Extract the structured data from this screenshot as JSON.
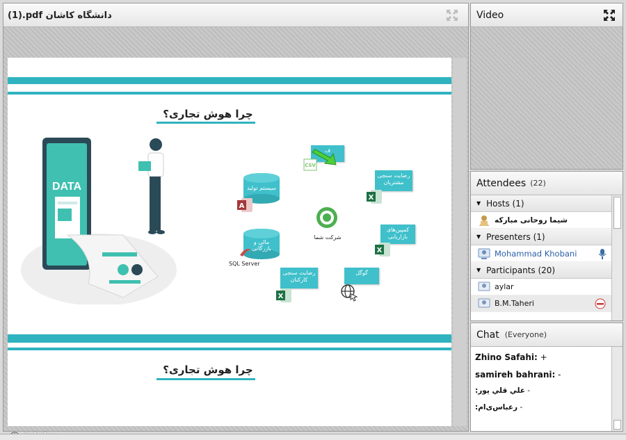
{
  "share": {
    "title": "(1).pdf دانشگاه کاشان",
    "slide": {
      "title": "چرا هوش تجاری؟",
      "title2": "چرا هوش تجاری؟",
      "data_label": "DATA",
      "cyl1": "سیستم تولید",
      "cyl2": "مالی و بازرگانی",
      "sql_server": "SQL Server",
      "company": "شرکت شما",
      "card_top": "ف",
      "card_customer": "رضایت سنجی مشتریان",
      "card_marketing": "کمپین‌های بازاریابی",
      "card_staff": "رضایت سنجی کارکنان",
      "card_google": "گوگل",
      "csv_label": "CSV"
    },
    "watermark": "/ukdsa"
  },
  "video": {
    "title": "Video"
  },
  "attendees": {
    "title": "Attendees",
    "count": "(22)",
    "hosts": {
      "label": "Hosts (1)",
      "members": [
        "شیما روحانی مبارکه"
      ]
    },
    "presenters": {
      "label": "Presenters (1)",
      "members": [
        "Mohammad Khobani"
      ]
    },
    "participants": {
      "label": "Participants (20)",
      "members": [
        "aylar",
        "B.M.Taheri"
      ]
    }
  },
  "chat": {
    "title": "Chat",
    "scope": "(Everyone)",
    "messages": [
      {
        "author": "Zhino Safahi:",
        "text": " +"
      },
      {
        "author": "samireh bahrani:",
        "text": " -"
      },
      {
        "author": "علي قلي پور:",
        "text": " -"
      },
      {
        "author": "رعباس‌ی‌ام:",
        "text": " -"
      }
    ]
  },
  "colors": {
    "teal": "#2fb3bf",
    "presenter_blue": "#2a5fa8",
    "excel_green": "#1e7145"
  },
  "icons": [
    "maximize-icon",
    "excel-icon",
    "access-icon",
    "sql-server-icon",
    "globe-icon",
    "user-icon",
    "microphone-icon",
    "remove-icon"
  ]
}
